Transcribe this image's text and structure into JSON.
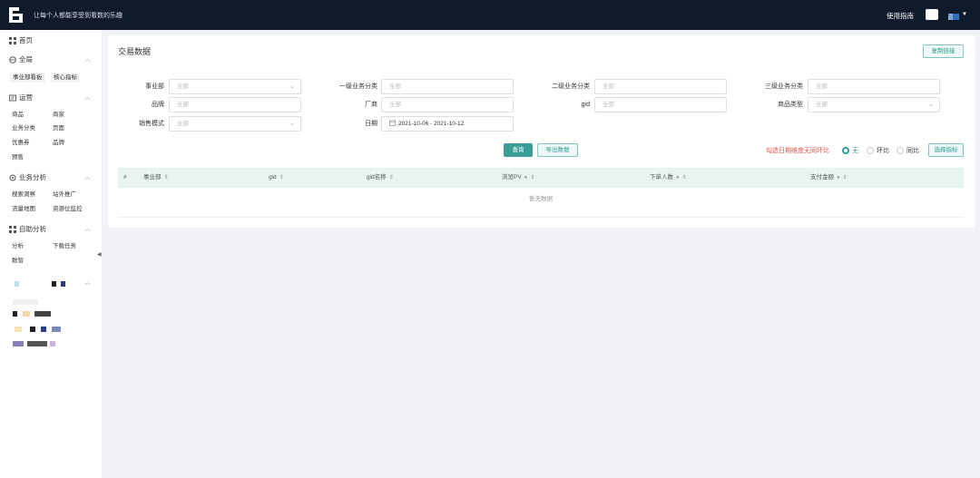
{
  "topbar": {
    "slogan": "让每个人都能享受到看数的乐趣",
    "guide_label": "使用指南"
  },
  "sidebar": {
    "home": "首页",
    "sections": [
      {
        "title": "全局",
        "items": [
          "事业部看板",
          "核心指标"
        ]
      },
      {
        "title": "运营",
        "items": [
          "商品",
          "商家",
          "业务分类",
          "页面",
          "优惠券",
          "品牌",
          "预售"
        ]
      },
      {
        "title": "业务分析",
        "items": [
          "搜索洞察",
          "站外推广",
          "流量地图",
          "资源位监控"
        ]
      },
      {
        "title": "自助分析",
        "items": [
          "分析",
          "下载任务",
          "数智"
        ]
      }
    ]
  },
  "card": {
    "title": "交易数据",
    "copy_link": "复制链接"
  },
  "filters": {
    "department": {
      "label": "事业部",
      "placeholder": "全部"
    },
    "category1": {
      "label": "一级业务分类",
      "placeholder": "全部"
    },
    "category2": {
      "label": "二级业务分类",
      "placeholder": "全部"
    },
    "category3": {
      "label": "三级业务分类",
      "placeholder": "全部"
    },
    "brand": {
      "label": "品牌",
      "placeholder": "全部"
    },
    "vendor": {
      "label": "厂商",
      "placeholder": "全部"
    },
    "gid": {
      "label": "gid",
      "placeholder": "全部"
    },
    "product_type": {
      "label": "商品类型",
      "placeholder": "全部"
    },
    "sales_mode": {
      "label": "销售模式",
      "placeholder": "全部"
    },
    "date": {
      "label": "日期",
      "value": "2021-10-06 - 2021-10-12"
    }
  },
  "actions": {
    "query": "查询",
    "export": "导出数据",
    "note": "勾选日期维度无同环比",
    "radio_none": "无",
    "radio_mom": "环比",
    "radio_yoy": "同比",
    "select_indicators": "选择指标"
  },
  "table": {
    "columns": [
      "#",
      "事业部",
      "gid",
      "gid名称",
      "浏览PV",
      "下单人数",
      "支付金额"
    ],
    "empty": "暂无数据"
  },
  "colors": {
    "topbar": "#0f1a2a",
    "primary": "#3a9e96",
    "warning_text": "#e0534b",
    "table_header": "#e8f4f1"
  }
}
